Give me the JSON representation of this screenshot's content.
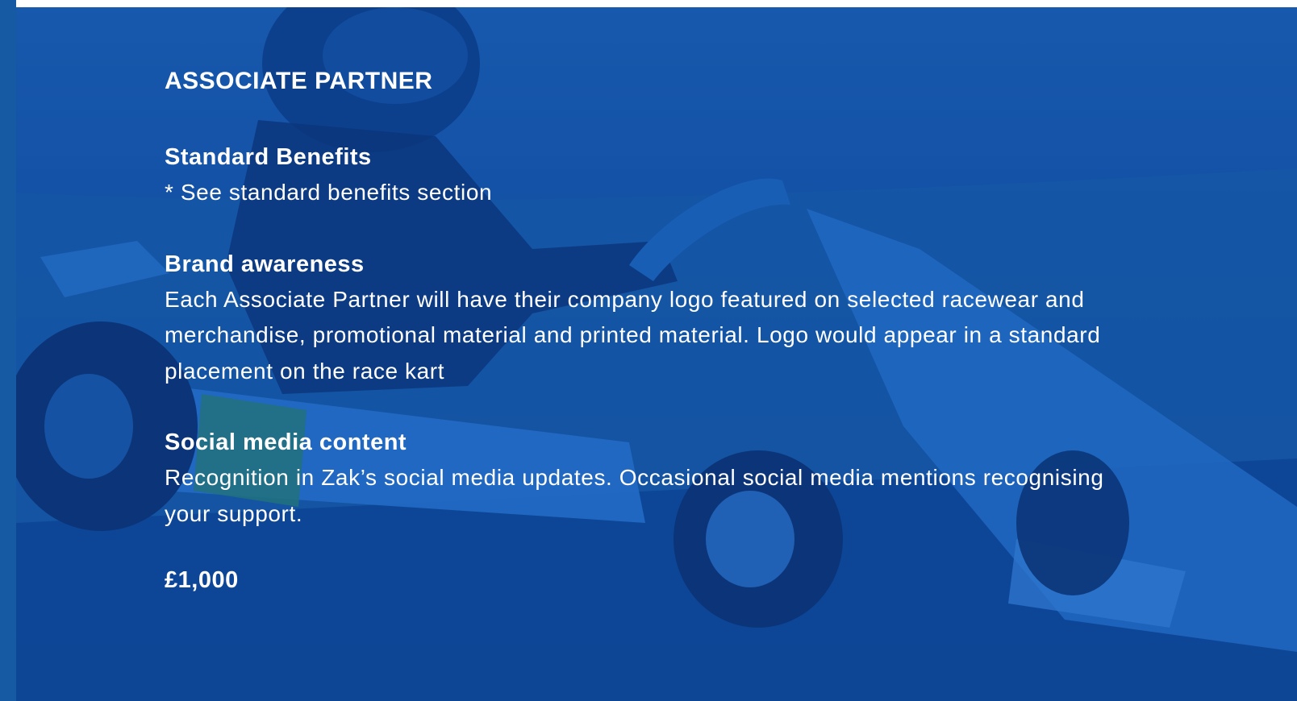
{
  "tier": {
    "title": "ASSOCIATE PARTNER",
    "price": "£1,000"
  },
  "sections": [
    {
      "heading": "Standard Benefits",
      "body": "* See standard benefits section"
    },
    {
      "heading": "Brand awareness",
      "body": "Each Associate Partner will have their company logo featured on selected racewear and merchandise, promotional material and printed material. Logo would appear in a standard placement on the race kart"
    },
    {
      "heading": "Social media content",
      "body": "Recognition in Zak’s social media updates. Occasional social media mentions recognising your support."
    }
  ],
  "background": {
    "image": "go-kart-racing-photo",
    "tint_color": "#1656a8"
  }
}
